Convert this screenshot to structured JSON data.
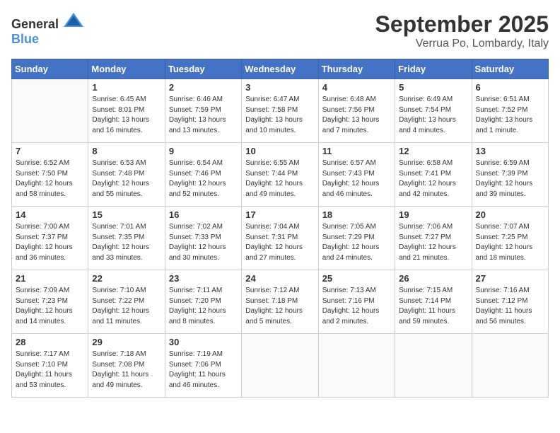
{
  "logo": {
    "general": "General",
    "blue": "Blue"
  },
  "title": "September 2025",
  "location": "Verrua Po, Lombardy, Italy",
  "weekdays": [
    "Sunday",
    "Monday",
    "Tuesday",
    "Wednesday",
    "Thursday",
    "Friday",
    "Saturday"
  ],
  "weeks": [
    [
      {
        "day": "",
        "info": ""
      },
      {
        "day": "1",
        "info": "Sunrise: 6:45 AM\nSunset: 8:01 PM\nDaylight: 13 hours\nand 16 minutes."
      },
      {
        "day": "2",
        "info": "Sunrise: 6:46 AM\nSunset: 7:59 PM\nDaylight: 13 hours\nand 13 minutes."
      },
      {
        "day": "3",
        "info": "Sunrise: 6:47 AM\nSunset: 7:58 PM\nDaylight: 13 hours\nand 10 minutes."
      },
      {
        "day": "4",
        "info": "Sunrise: 6:48 AM\nSunset: 7:56 PM\nDaylight: 13 hours\nand 7 minutes."
      },
      {
        "day": "5",
        "info": "Sunrise: 6:49 AM\nSunset: 7:54 PM\nDaylight: 13 hours\nand 4 minutes."
      },
      {
        "day": "6",
        "info": "Sunrise: 6:51 AM\nSunset: 7:52 PM\nDaylight: 13 hours\nand 1 minute."
      }
    ],
    [
      {
        "day": "7",
        "info": "Sunrise: 6:52 AM\nSunset: 7:50 PM\nDaylight: 12 hours\nand 58 minutes."
      },
      {
        "day": "8",
        "info": "Sunrise: 6:53 AM\nSunset: 7:48 PM\nDaylight: 12 hours\nand 55 minutes."
      },
      {
        "day": "9",
        "info": "Sunrise: 6:54 AM\nSunset: 7:46 PM\nDaylight: 12 hours\nand 52 minutes."
      },
      {
        "day": "10",
        "info": "Sunrise: 6:55 AM\nSunset: 7:44 PM\nDaylight: 12 hours\nand 49 minutes."
      },
      {
        "day": "11",
        "info": "Sunrise: 6:57 AM\nSunset: 7:43 PM\nDaylight: 12 hours\nand 46 minutes."
      },
      {
        "day": "12",
        "info": "Sunrise: 6:58 AM\nSunset: 7:41 PM\nDaylight: 12 hours\nand 42 minutes."
      },
      {
        "day": "13",
        "info": "Sunrise: 6:59 AM\nSunset: 7:39 PM\nDaylight: 12 hours\nand 39 minutes."
      }
    ],
    [
      {
        "day": "14",
        "info": "Sunrise: 7:00 AM\nSunset: 7:37 PM\nDaylight: 12 hours\nand 36 minutes."
      },
      {
        "day": "15",
        "info": "Sunrise: 7:01 AM\nSunset: 7:35 PM\nDaylight: 12 hours\nand 33 minutes."
      },
      {
        "day": "16",
        "info": "Sunrise: 7:02 AM\nSunset: 7:33 PM\nDaylight: 12 hours\nand 30 minutes."
      },
      {
        "day": "17",
        "info": "Sunrise: 7:04 AM\nSunset: 7:31 PM\nDaylight: 12 hours\nand 27 minutes."
      },
      {
        "day": "18",
        "info": "Sunrise: 7:05 AM\nSunset: 7:29 PM\nDaylight: 12 hours\nand 24 minutes."
      },
      {
        "day": "19",
        "info": "Sunrise: 7:06 AM\nSunset: 7:27 PM\nDaylight: 12 hours\nand 21 minutes."
      },
      {
        "day": "20",
        "info": "Sunrise: 7:07 AM\nSunset: 7:25 PM\nDaylight: 12 hours\nand 18 minutes."
      }
    ],
    [
      {
        "day": "21",
        "info": "Sunrise: 7:09 AM\nSunset: 7:23 PM\nDaylight: 12 hours\nand 14 minutes."
      },
      {
        "day": "22",
        "info": "Sunrise: 7:10 AM\nSunset: 7:22 PM\nDaylight: 12 hours\nand 11 minutes."
      },
      {
        "day": "23",
        "info": "Sunrise: 7:11 AM\nSunset: 7:20 PM\nDaylight: 12 hours\nand 8 minutes."
      },
      {
        "day": "24",
        "info": "Sunrise: 7:12 AM\nSunset: 7:18 PM\nDaylight: 12 hours\nand 5 minutes."
      },
      {
        "day": "25",
        "info": "Sunrise: 7:13 AM\nSunset: 7:16 PM\nDaylight: 12 hours\nand 2 minutes."
      },
      {
        "day": "26",
        "info": "Sunrise: 7:15 AM\nSunset: 7:14 PM\nDaylight: 11 hours\nand 59 minutes."
      },
      {
        "day": "27",
        "info": "Sunrise: 7:16 AM\nSunset: 7:12 PM\nDaylight: 11 hours\nand 56 minutes."
      }
    ],
    [
      {
        "day": "28",
        "info": "Sunrise: 7:17 AM\nSunset: 7:10 PM\nDaylight: 11 hours\nand 53 minutes."
      },
      {
        "day": "29",
        "info": "Sunrise: 7:18 AM\nSunset: 7:08 PM\nDaylight: 11 hours\nand 49 minutes."
      },
      {
        "day": "30",
        "info": "Sunrise: 7:19 AM\nSunset: 7:06 PM\nDaylight: 11 hours\nand 46 minutes."
      },
      {
        "day": "",
        "info": ""
      },
      {
        "day": "",
        "info": ""
      },
      {
        "day": "",
        "info": ""
      },
      {
        "day": "",
        "info": ""
      }
    ]
  ]
}
